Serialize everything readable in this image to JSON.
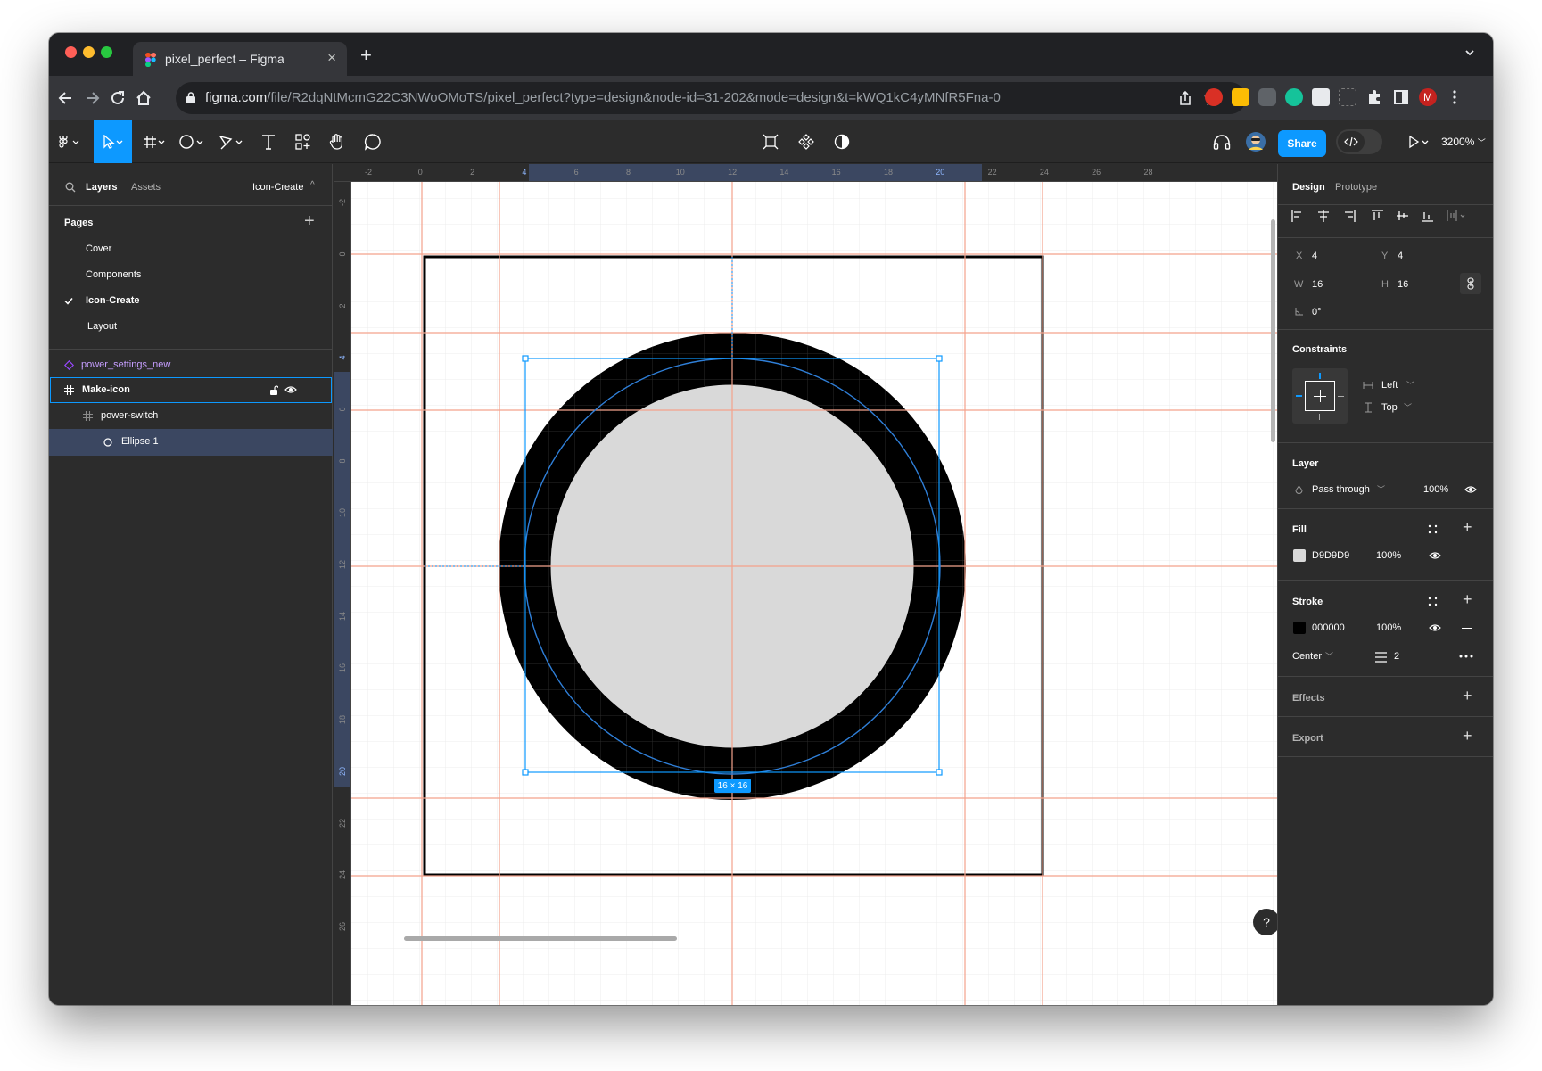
{
  "browser": {
    "tab_title": "pixel_perfect – Figma",
    "url_host": "figma.com",
    "url_path": "/file/R2dqNtMcmG22C3NWoOMoTS/pixel_perfect?type=design&node-id=31-202&mode=design&t=kWQ1kC4yMNfR5Fna-0",
    "profile_initial": "M"
  },
  "toolbar": {
    "share_label": "Share",
    "zoom_label": "3200%"
  },
  "left_panel": {
    "tabs": [
      "Layers",
      "Assets"
    ],
    "current_page": "Icon-Create",
    "pages_heading": "Pages",
    "pages": [
      {
        "label": "Cover",
        "selected": false
      },
      {
        "label": "Components",
        "selected": false
      },
      {
        "label": "Icon-Create",
        "selected": true
      },
      {
        "label": "Layout",
        "selected": false
      }
    ],
    "layers": [
      {
        "label": "power_settings_new",
        "icon": "component-icon"
      },
      {
        "label": "Make-icon",
        "icon": "frame-icon"
      },
      {
        "label": "power-switch",
        "icon": "frame-icon"
      },
      {
        "label": "Ellipse 1",
        "icon": "ellipse-icon"
      }
    ]
  },
  "rulers": {
    "top": [
      "-2",
      "0",
      "2",
      "4",
      "6",
      "8",
      "10",
      "12",
      "14",
      "16",
      "18",
      "20",
      "22",
      "24",
      "26",
      "28"
    ],
    "left": [
      "-2",
      "0",
      "2",
      "4",
      "6",
      "8",
      "10",
      "12",
      "14",
      "16",
      "18",
      "20",
      "22",
      "24",
      "26"
    ]
  },
  "canvas": {
    "size_badge": "16 × 16",
    "fill_color": "#D9D9D9",
    "stroke_color": "#000000",
    "selection_color": "#0d99ff",
    "grid_line_color": "#f24822"
  },
  "right_panel": {
    "tabs": [
      "Design",
      "Prototype"
    ],
    "x_label": "X",
    "x": "4",
    "y_label": "Y",
    "y": "4",
    "w_label": "W",
    "w": "16",
    "h_label": "H",
    "h": "16",
    "rotation": "0°",
    "constraints_heading": "Constraints",
    "constraint_h": "Left",
    "constraint_v": "Top",
    "layer_heading": "Layer",
    "blend_mode": "Pass through",
    "layer_opacity": "100%",
    "fill_heading": "Fill",
    "fill_hex": "D9D9D9",
    "fill_opacity": "100%",
    "stroke_heading": "Stroke",
    "stroke_hex": "000000",
    "stroke_opacity": "100%",
    "stroke_align": "Center",
    "stroke_weight": "2",
    "effects_heading": "Effects",
    "export_heading": "Export"
  },
  "help_label": "?"
}
